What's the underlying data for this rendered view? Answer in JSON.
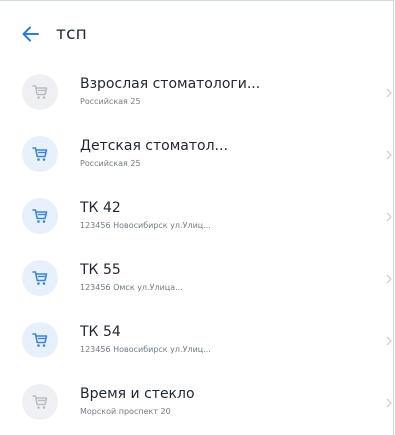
{
  "header": {
    "title": "тсп",
    "back_icon": "arrow-left-icon",
    "accent_color": "#2e7bd3"
  },
  "list": {
    "items": [
      {
        "title": "Взрослая стоматологи...",
        "subtitle": "Российская 25",
        "icon": "cart-icon",
        "state": "inactive"
      },
      {
        "title": "Детская стоматол...",
        "subtitle": "Российская 25",
        "icon": "cart-icon",
        "state": "active"
      },
      {
        "title": "ТК 42",
        "subtitle": "123456 Новосибирск ул.Улиц...",
        "icon": "cart-icon",
        "state": "active"
      },
      {
        "title": "ТК 55",
        "subtitle": "123456 Омск ул.Улица...",
        "icon": "cart-icon",
        "state": "active"
      },
      {
        "title": "ТК 54",
        "subtitle": "123456 Новосибирск ул.Улиц...",
        "icon": "cart-icon",
        "state": "active"
      },
      {
        "title": "Время и стекло",
        "subtitle": "Морской проспект 20",
        "icon": "cart-icon",
        "state": "inactive"
      }
    ],
    "colors": {
      "active_icon": "#3a86d6",
      "inactive_icon": "#b8bdc4",
      "chevron": "#c8ccd2"
    }
  }
}
